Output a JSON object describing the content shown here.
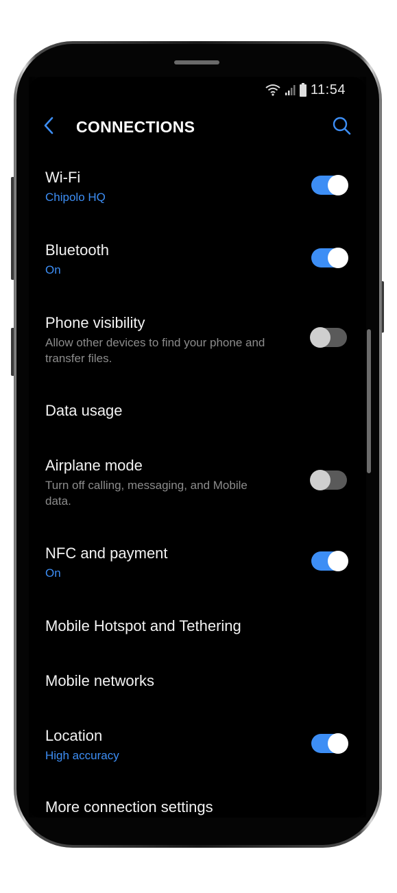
{
  "status_bar": {
    "time": "11:54",
    "icons": [
      "wifi-icon",
      "signal-icon",
      "battery-icon"
    ]
  },
  "header": {
    "title": "CONNECTIONS",
    "back_icon": "back-arrow-icon",
    "search_icon": "search-icon"
  },
  "colors": {
    "accent": "#3d8ef5",
    "background": "#000000",
    "text_primary": "#f2f2f2",
    "text_secondary": "#8c8c8c"
  },
  "settings": [
    {
      "title": "Wi-Fi",
      "subtitle": "Chipolo HQ",
      "toggle": "on"
    },
    {
      "title": "Bluetooth",
      "subtitle": "On",
      "toggle": "on"
    },
    {
      "title": "Phone visibility",
      "description": "Allow other devices to find your phone and transfer files.",
      "toggle": "off"
    },
    {
      "title": "Data usage"
    },
    {
      "title": "Airplane mode",
      "description": "Turn off calling, messaging, and Mobile data.",
      "toggle": "off"
    },
    {
      "title": "NFC and payment",
      "subtitle": "On",
      "toggle": "on"
    },
    {
      "title": "Mobile Hotspot and Tethering"
    },
    {
      "title": "Mobile networks"
    },
    {
      "title": "Location",
      "subtitle": "High accuracy",
      "toggle": "on"
    },
    {
      "title": "More connection settings"
    }
  ]
}
